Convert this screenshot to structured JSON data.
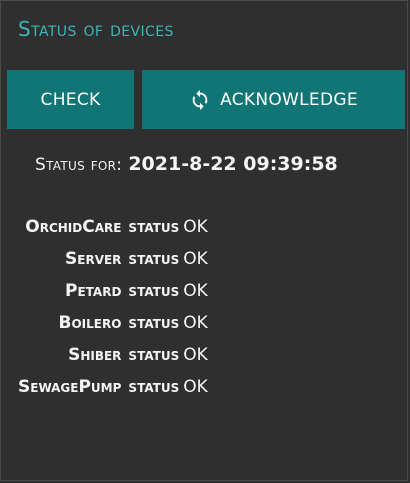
{
  "title": "Status of devices",
  "buttons": {
    "check_label": "CHECK",
    "acknowledge_label": "ACKNOWLEDGE",
    "acknowledge_icon": "refresh-icon"
  },
  "status_for": {
    "label": "Status for:",
    "timestamp": "2021-8-22 09:39:58"
  },
  "devices": [
    {
      "name": "OrchidCare",
      "status_word": "status",
      "status_value": "OK"
    },
    {
      "name": "Server",
      "status_word": "status",
      "status_value": "OK"
    },
    {
      "name": "Petard",
      "status_word": "status",
      "status_value": "OK"
    },
    {
      "name": "Boilero",
      "status_word": "status",
      "status_value": "OK"
    },
    {
      "name": "Shiber",
      "status_word": "status",
      "status_value": "OK"
    },
    {
      "name": "SewagePump",
      "status_word": "status",
      "status_value": "OK"
    }
  ],
  "colors": {
    "background": "#2f2f2f",
    "accent_title": "#3bb7b7",
    "button": "#117475",
    "text": "#f4f4f4"
  }
}
